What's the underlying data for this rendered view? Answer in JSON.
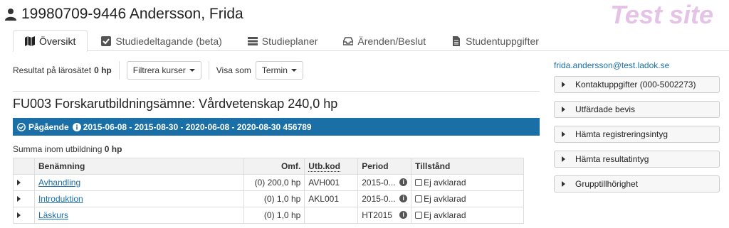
{
  "header": {
    "name": "19980709-9446 Andersson, Frida",
    "badge": "Test site"
  },
  "tabs": [
    {
      "label": "Översikt",
      "icon": "map-icon",
      "active": true
    },
    {
      "label": "Studiedeltagande (beta)",
      "icon": "checkbox-icon",
      "active": false
    },
    {
      "label": "Studieplaner",
      "icon": "list-icon",
      "active": false
    },
    {
      "label": "Ärenden/Beslut",
      "icon": "inbox-icon",
      "active": false
    },
    {
      "label": "Studentuppgifter",
      "icon": "document-icon",
      "active": false
    }
  ],
  "toolbar": {
    "result_label": "Resultat på lärosätet",
    "result_value": "0 hp",
    "filter_label": "Filtrera kurser",
    "view_label": "Visa som",
    "view_value": "Termin"
  },
  "program": {
    "title": "FU003 Forskarutbildningsämne: Vårdvetenskap 240,0 hp",
    "status": "Pågående",
    "dates": "2015-06-08 - 2015-08-30 - 2020-06-08 - 2020-08-30 456789",
    "summa_label": "Summa inom utbildning",
    "summa_value": "0 hp"
  },
  "table": {
    "headers": [
      "Benämning",
      "Omf.",
      "Utb.kod",
      "Period",
      "Tillstånd"
    ],
    "rows": [
      {
        "name": "Avhandling",
        "omf": "(0) 200,0 hp",
        "kod": "AVH001",
        "period": "2015-0...",
        "state": "Ej avklarad"
      },
      {
        "name": "Introduktion",
        "omf": "(0) 1,0 hp",
        "kod": "AKL001",
        "period": "2015-0...",
        "state": "Ej avklarad"
      },
      {
        "name": "Läskurs",
        "omf": "(0) 1,0 hp",
        "kod": "",
        "period": "HT2015",
        "state": "Ej avklarad"
      }
    ]
  },
  "sidebar": {
    "email": "frida.andersson@test.ladok.se",
    "buttons": [
      "Kontaktuppgifter (000-5002273)",
      "Utfärdade bevis",
      "Hämta registreringsintyg",
      "Hämta resultatintyg",
      "Grupptillhörighet"
    ]
  },
  "colors": {
    "accent": "#1a6fa7",
    "badge": "#e4c3e6"
  }
}
